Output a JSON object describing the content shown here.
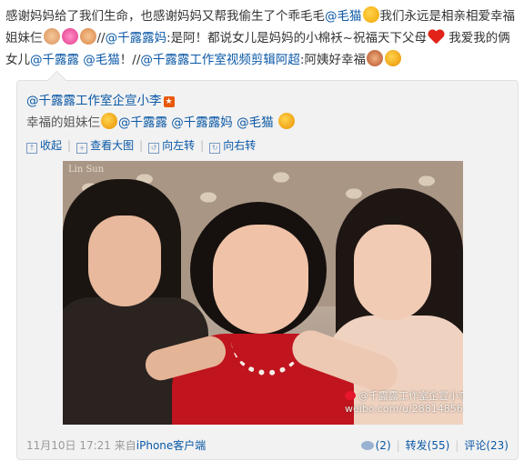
{
  "post": {
    "seg1": "感谢妈妈给了我们生命，也感谢妈妈又帮我偷生了个乖毛毛",
    "mention_maomao": "@毛猫",
    "seg2": "我们永远是相亲相爱幸福姐妹仨",
    "seg3": "//",
    "mention_qianlulu_mama": "@千露露妈",
    "seg4": ":是阿！都说女儿是妈妈的小棉袄~祝福天下父母",
    "seg5": "我爱我的俩女儿",
    "mention_qianlulu": "@千露露",
    "mention_maomao2": "@毛猫",
    "seg6": "！//",
    "mention_studio": "@千露露工作室视频剪辑阿超",
    "seg7": ":阿姨好幸福"
  },
  "repost": {
    "author": "@千露露工作室企宣小李",
    "text": "幸福的姐妹仨",
    "mention_qianlulu": "@千露露",
    "mention_qianlulu_mama": "@千露露妈",
    "mention_maomao": "@毛猫",
    "toolbar": {
      "collapse": "收起",
      "view_large": "查看大图",
      "rotate_left": "向左转",
      "rotate_right": "向右转"
    },
    "photo": {
      "watermark_top": "Lin Sun",
      "watermark_line1": "@千露露工作室企宣小李",
      "watermark_line2": "weibo.com/u/2881485677"
    },
    "footer": {
      "time": "11月10日 17:21",
      "from": "来自",
      "client": "iPhone客户端",
      "likes": "(2)",
      "repost": "转发(55)",
      "comment": "评论(23)"
    }
  }
}
